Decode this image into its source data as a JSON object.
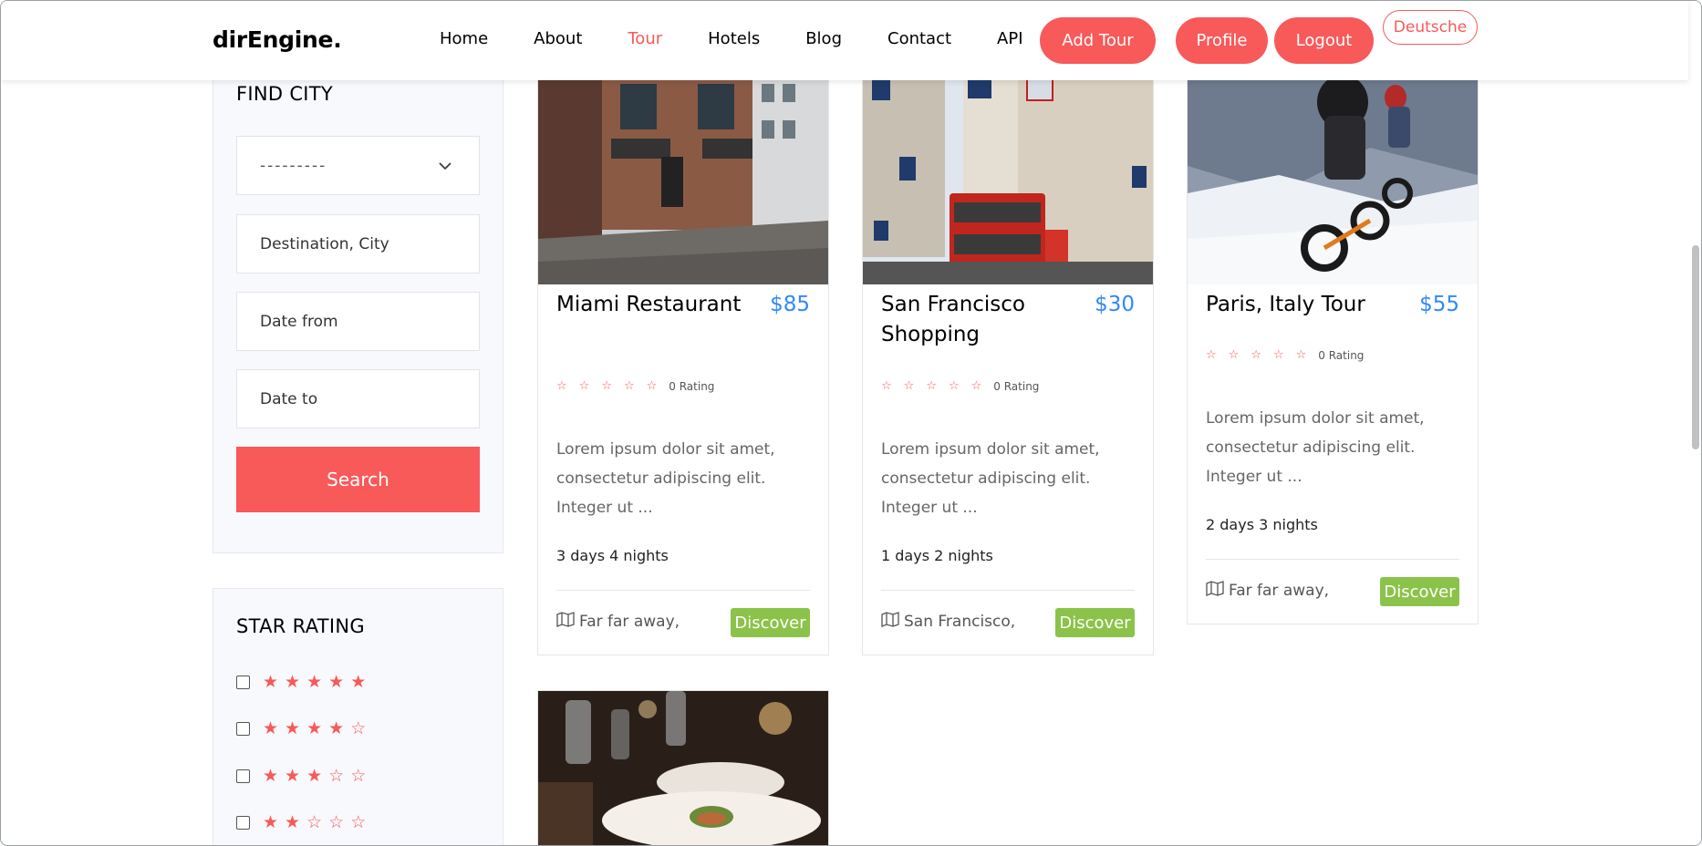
{
  "brand": "dirEngine.",
  "nav": {
    "links": [
      "Home",
      "About",
      "Tour",
      "Hotels",
      "Blog",
      "Contact",
      "API"
    ],
    "active": "Tour",
    "add_tour": "Add Tour",
    "profile": "Profile",
    "logout": "Logout",
    "language": "Deutsche"
  },
  "sidebar": {
    "find_title": "FIND CITY",
    "select_value": "---------",
    "destination_placeholder": "Destination, City",
    "date_from_placeholder": "Date from",
    "date_to_placeholder": "Date to",
    "search_label": "Search",
    "star_title": "STAR RATING",
    "star_filters": [
      5,
      4,
      3,
      2
    ]
  },
  "tours": [
    {
      "title": "Miami Restaurant",
      "price": "$85",
      "stars": 0,
      "rating_text": "0 Rating",
      "description": "Lorem ipsum dolor sit amet, consectetur adipiscing elit. Integer ut ...",
      "duration": "3 days 4 nights",
      "location": "Far far away,",
      "discover": "Discover"
    },
    {
      "title": "San Francisco Shopping",
      "price": "$30",
      "stars": 0,
      "rating_text": "0 Rating",
      "description": "Lorem ipsum dolor sit amet, consectetur adipiscing elit. Integer ut ...",
      "duration": "1 days 2 nights",
      "location": "San Francisco,",
      "discover": "Discover"
    },
    {
      "title": "Paris, Italy Tour",
      "price": "$55",
      "stars": 0,
      "rating_text": "0 Rating",
      "description": "Lorem ipsum dolor sit amet, consectetur adipiscing elit. Integer ut ...",
      "duration": "2 days 3 nights",
      "location": "Far far away,",
      "discover": "Discover"
    }
  ],
  "colors": {
    "accent": "#f85959",
    "price": "#2f89fc",
    "discover": "#8bc34a",
    "panel_bg": "#f8f9fd"
  }
}
